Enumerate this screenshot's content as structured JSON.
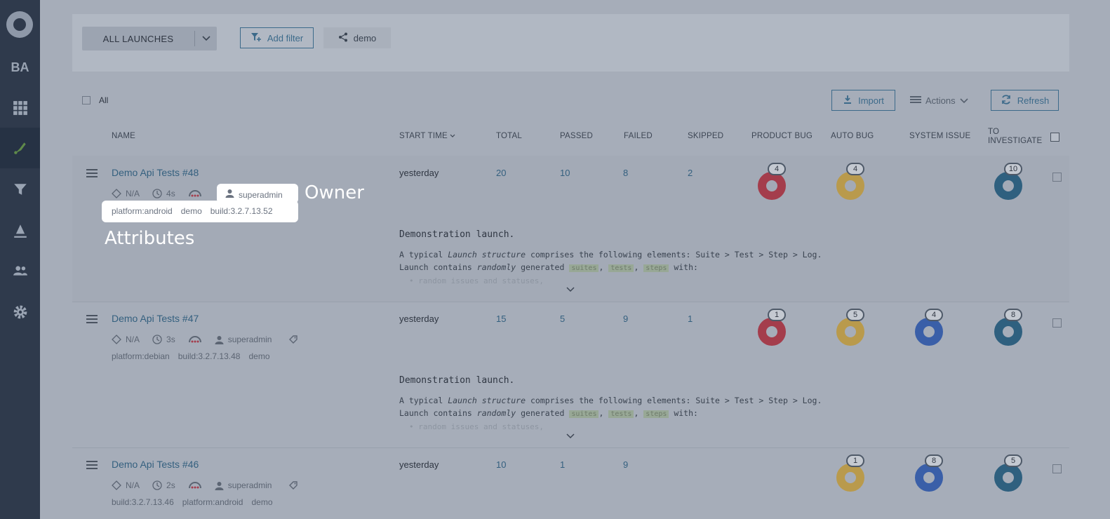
{
  "sidebar": {
    "project_badge": "BA",
    "items": [
      "dashboard-icon",
      "launches-icon",
      "filters-icon",
      "debug-icon",
      "members-icon",
      "settings-icon"
    ]
  },
  "filter_bar": {
    "select_label": "ALL LAUNCHES",
    "add_filter_label": "Add filter",
    "share_label": "demo"
  },
  "toolbar": {
    "all_label": "All",
    "import_label": "Import",
    "actions_label": "Actions",
    "refresh_label": "Refresh"
  },
  "table": {
    "headers": {
      "name": "NAME",
      "start_time": "START TIME",
      "total": "TOTAL",
      "passed": "PASSED",
      "failed": "FAILED",
      "skipped": "SKIPPED",
      "product_bug": "PRODUCT BUG",
      "auto_bug": "AUTO BUG",
      "system_issue": "SYSTEM ISSUE",
      "to_investigate_1": "TO",
      "to_investigate_2": "INVESTIGATE"
    },
    "rows": [
      {
        "name": "Demo Api Tests",
        "number": "#48",
        "na": "N/A",
        "duration": "4s",
        "owner": "superadmin",
        "attributes": [
          "platform:android",
          "demo",
          "build:3.2.7.13.52"
        ],
        "start_time": "yesterday",
        "total": "20",
        "passed": "10",
        "failed": "8",
        "skipped": "2",
        "product_bug": "4",
        "auto_bug": "4",
        "system_issue": "",
        "to_investigate": "10",
        "desc_title": "Demonstration launch.",
        "desc_l1a": "A typical ",
        "desc_l1b": "Launch structure",
        "desc_l1c": " comprises the following elements: Suite > Test > Step > Log.",
        "desc_l2a": "Launch contains ",
        "desc_l2b": "randomly",
        "desc_l2c": " generated ",
        "chip1": "suites",
        "chip2": "tests",
        "chip3": "steps",
        "desc_l2d": " with:",
        "desc_fade": "• random issues and statuses,"
      },
      {
        "name": "Demo Api Tests",
        "number": "#47",
        "na": "N/A",
        "duration": "3s",
        "owner": "superadmin",
        "attributes": [
          "platform:debian",
          "build:3.2.7.13.48",
          "demo"
        ],
        "start_time": "yesterday",
        "total": "15",
        "passed": "5",
        "failed": "9",
        "skipped": "1",
        "product_bug": "1",
        "auto_bug": "5",
        "system_issue": "4",
        "to_investigate": "8",
        "desc_title": "Demonstration launch.",
        "desc_l1a": "A typical ",
        "desc_l1b": "Launch structure",
        "desc_l1c": " comprises the following elements: Suite > Test > Step > Log.",
        "desc_l2a": "Launch contains ",
        "desc_l2b": "randomly",
        "desc_l2c": " generated ",
        "chip1": "suites",
        "chip2": "tests",
        "chip3": "steps",
        "desc_l2d": " with:",
        "desc_fade": "• random issues and statuses,"
      },
      {
        "name": "Demo Api Tests",
        "number": "#46",
        "na": "N/A",
        "duration": "2s",
        "owner": "superadmin",
        "attributes": [
          "build:3.2.7.13.46",
          "platform:android",
          "demo"
        ],
        "start_time": "yesterday",
        "total": "10",
        "passed": "1",
        "failed": "9",
        "skipped": "",
        "product_bug": "",
        "auto_bug": "1",
        "system_issue": "8",
        "to_investigate": "5"
      }
    ]
  },
  "callouts": {
    "owner": "Owner",
    "attributes": "Attributes"
  },
  "colors": {
    "product_bug": "#a43d4c",
    "auto_bug": "#b99a4c",
    "system_issue": "#3a5fa8",
    "to_investigate": "#2f607f"
  }
}
